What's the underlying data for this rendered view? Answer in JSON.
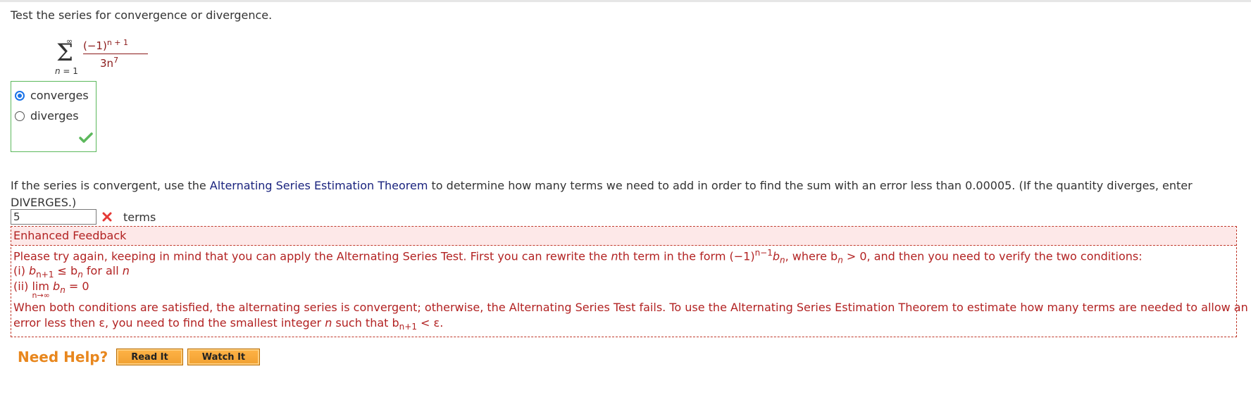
{
  "question1": {
    "prompt": "Test the series for convergence or divergence.",
    "series": {
      "sigma": "Σ",
      "upper": "∞",
      "lower_var": "n",
      "lower_rest": " = 1",
      "num_base": "(−1)",
      "num_exp": "n + 1",
      "den_base": "3n",
      "den_exp": "7"
    },
    "options": [
      {
        "label": "converges",
        "selected": true
      },
      {
        "label": "diverges",
        "selected": false
      }
    ],
    "status": "correct"
  },
  "question2": {
    "text_before": "If the series is convergent, use the ",
    "link": "Alternating Series Estimation Theorem",
    "text_after": " to determine how many terms we need to add in order to find the sum with an error less than 0.00005. (If the quantity diverges, enter DIVERGES.)",
    "answer_value": "5",
    "answer_status": "incorrect",
    "unit": "terms"
  },
  "feedback": {
    "title": "Enhanced Feedback",
    "line1_a": "Please try again, keeping in mind that you can apply the Alternating Series Test. First you can rewrite the ",
    "line1_n": "n",
    "line1_b": "th term in the form (−1)",
    "line1_exp": "n−1",
    "line1_c": "b",
    "line1_sub": "n",
    "line1_d": ", where b",
    "line1_sub2": "n",
    "line1_e": " > 0, and then you need to verify the two conditions:",
    "cond1_prefix": "(i) ",
    "cond1_b": "b",
    "cond1_sub": "n+1",
    "cond1_mid": " ≤ b",
    "cond1_sub2": "n",
    "cond1_end": " for all ",
    "cond1_n": "n",
    "cond2_prefix": "(ii) ",
    "cond2_lim": "lim",
    "cond2_limsub": "n→∞",
    "cond2_b": " b",
    "cond2_sub": "n",
    "cond2_end": " = 0",
    "line4": "When both conditions are satisfied, the alternating series is convergent; otherwise, the Alternating Series Test fails. To use the Alternating Series Estimation Theorem to estimate how many terms are needed to allow an",
    "line5_a": "error less then ε, you need to find the smallest integer ",
    "line5_n": "n",
    "line5_b": " such that b",
    "line5_sub": "n+1",
    "line5_c": " < ε."
  },
  "help": {
    "label": "Need Help?",
    "read_it": "Read It",
    "watch_it": "Watch It"
  },
  "colors": {
    "correct": "#5cb85c",
    "incorrect": "#e53935",
    "feedback_text": "#b22222",
    "link": "#1a237e",
    "help_accent": "#e8871e"
  }
}
